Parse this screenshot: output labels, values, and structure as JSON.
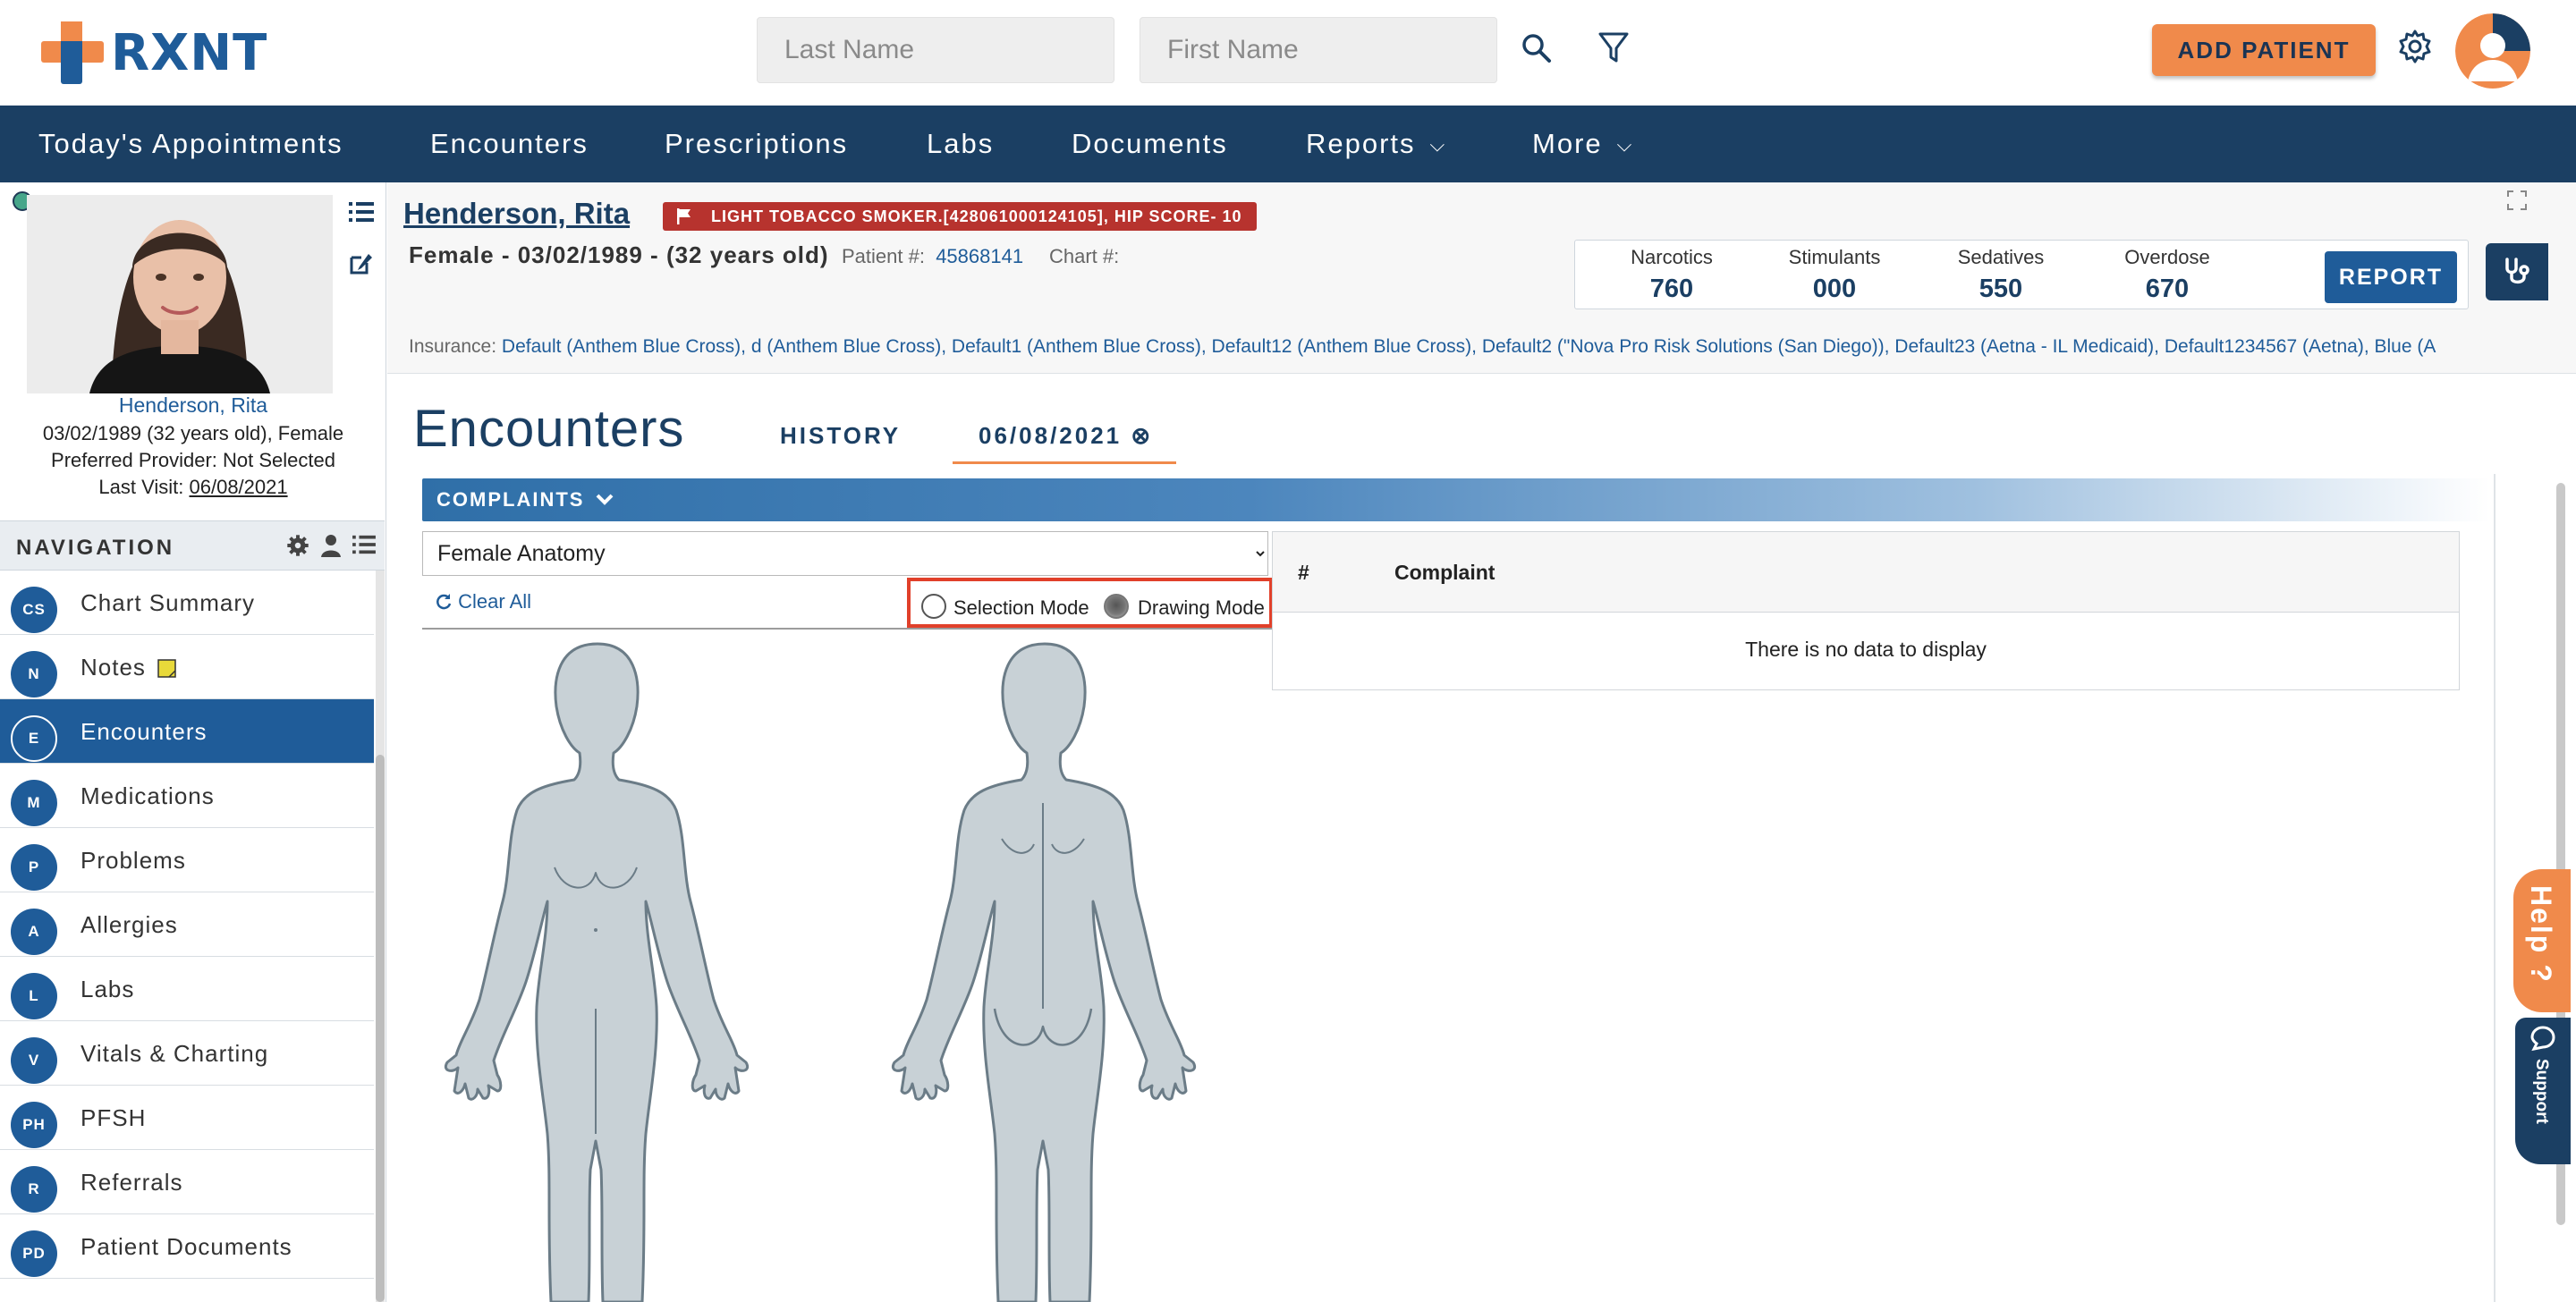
{
  "header": {
    "logo_text": "RXNT",
    "last_name_placeholder": "Last Name",
    "first_name_placeholder": "First Name",
    "add_patient_label": "ADD PATIENT"
  },
  "nav": {
    "items": [
      {
        "label": "Today's Appointments"
      },
      {
        "label": "Encounters"
      },
      {
        "label": "Prescriptions"
      },
      {
        "label": "Labs"
      },
      {
        "label": "Documents"
      },
      {
        "label": "Reports"
      },
      {
        "label": "More"
      }
    ]
  },
  "sidebar": {
    "patient_name": "Henderson, Rita",
    "dob_line": "03/02/1989 (32 years old), Female",
    "provider_line": "Preferred Provider: Not Selected",
    "last_visit_label": "Last Visit:",
    "last_visit_value": "06/08/2021",
    "navigation_label": "NAVIGATION",
    "items": [
      {
        "abbr": "CS",
        "label": "Chart Summary"
      },
      {
        "abbr": "N",
        "label": "Notes"
      },
      {
        "abbr": "E",
        "label": "Encounters"
      },
      {
        "abbr": "M",
        "label": "Medications"
      },
      {
        "abbr": "P",
        "label": "Problems"
      },
      {
        "abbr": "A",
        "label": "Allergies"
      },
      {
        "abbr": "L",
        "label": "Labs"
      },
      {
        "abbr": "V",
        "label": "Vitals & Charting"
      },
      {
        "abbr": "PH",
        "label": "PFSH"
      },
      {
        "abbr": "R",
        "label": "Referrals"
      },
      {
        "abbr": "PD",
        "label": "Patient Documents"
      }
    ]
  },
  "patient": {
    "name": "Henderson, Rita",
    "flag_text": "LIGHT TOBACCO SMOKER.[428061000124105], HIP SCORE- 10",
    "demographics": "Female - 03/02/1989 - (32 years old)",
    "patient_no_label": "Patient #:",
    "patient_no_value": "45868141",
    "chart_no_label": "Chart #:",
    "insurance_label": "Insurance:",
    "insurance_value": "Default (Anthem Blue Cross), d (Anthem Blue Cross), Default1 (Anthem Blue Cross), Default12 (Anthem Blue Cross), Default2 (\"Nova Pro Risk Solutions (San Diego)), Default23 (Aetna - IL Medicaid), Default1234567 (Aetna), Blue (A"
  },
  "pdmp": {
    "cells": [
      {
        "label": "Narcotics",
        "value": "760"
      },
      {
        "label": "Stimulants",
        "value": "000"
      },
      {
        "label": "Sedatives",
        "value": "550"
      },
      {
        "label": "Overdose",
        "value": "670"
      }
    ],
    "report_label": "REPORT"
  },
  "encounter": {
    "title": "Encounters",
    "history_tab": "HISTORY",
    "date_tab": "06/08/2021 ⊗",
    "complaints_label": "COMPLAINTS",
    "anatomy_selected": "Female Anatomy",
    "clear_all_label": "Clear All",
    "selection_mode_label": "Selection Mode",
    "drawing_mode_label": "Drawing Mode",
    "table_cols": [
      "#",
      "Complaint"
    ],
    "empty_message": "There is no data to display"
  },
  "help": {
    "help_label": "Help ?",
    "support_label": "Support"
  },
  "colors": {
    "navy": "#1b3f63",
    "blue": "#1f5c99",
    "orange": "#f08a4b",
    "flag_red": "#b7332e",
    "highlight_red": "#e1402a"
  }
}
